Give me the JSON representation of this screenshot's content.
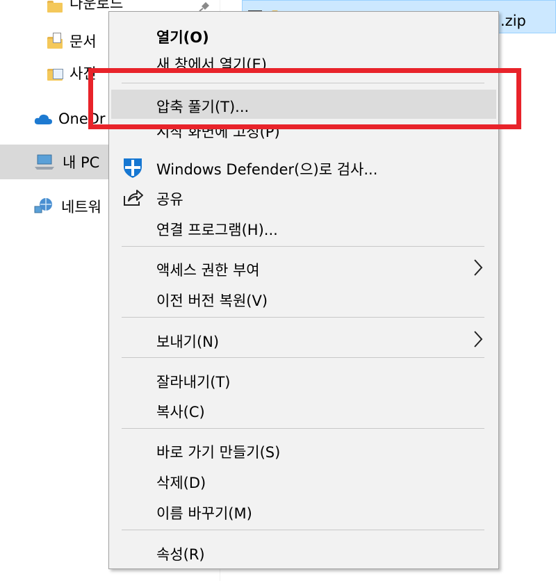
{
  "nav": {
    "downloads": "다운로드",
    "documents": "문서",
    "pictures": "사진",
    "onedrive": "OneDr",
    "this_pc": "내 PC",
    "network": "네트워"
  },
  "file": {
    "name_suffix": ".zip"
  },
  "menu": {
    "items": [
      {
        "label": "열기(O)"
      },
      {
        "label": "새 창에서 열기(E)"
      },
      {
        "label": "압축 풀기(T)..."
      },
      {
        "label": "시작 화면에 고정(P)"
      },
      {
        "label": "Windows Defender(으)로 검사..."
      },
      {
        "label": "공유"
      },
      {
        "label": "연결 프로그램(H)..."
      },
      {
        "label": "액세스 권한 부여"
      },
      {
        "label": "이전 버전 복원(V)"
      },
      {
        "label": "보내기(N)"
      },
      {
        "label": "잘라내기(T)"
      },
      {
        "label": "복사(C)"
      },
      {
        "label": "바로 가기 만들기(S)"
      },
      {
        "label": "삭제(D)"
      },
      {
        "label": "이름 바꾸기(M)"
      },
      {
        "label": "속성(R)"
      }
    ]
  },
  "colors": {
    "highlight_border": "#e8232a",
    "menu_bg": "#f2f2f2",
    "hover_bg": "#dcdcdc",
    "selection_bg": "#cce8ff"
  }
}
